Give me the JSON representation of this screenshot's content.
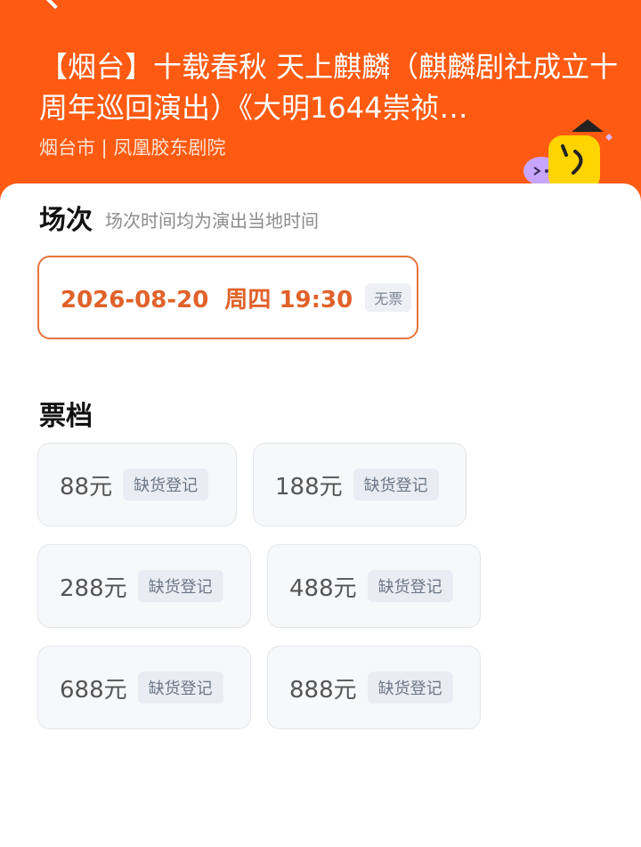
{
  "header": {
    "title": "【烟台】十载春秋 天上麒麟（麒麟剧社成立十周年巡回演出）《大明1644崇祯…",
    "venue": "烟台市 | 凤凰胶东剧院"
  },
  "sessions": {
    "heading": "场次",
    "note": "场次时间均为演出当地时间",
    "selected": {
      "datetime": "2026-08-20  周四 19:30",
      "status": "无票"
    }
  },
  "tiers": {
    "heading": "票档",
    "items": [
      {
        "price": "88元",
        "status": "缺货登记"
      },
      {
        "price": "188元",
        "status": "缺货登记"
      },
      {
        "price": "288元",
        "status": "缺货登记"
      },
      {
        "price": "488元",
        "status": "缺货登记"
      },
      {
        "price": "688元",
        "status": "缺货登记"
      },
      {
        "price": "888元",
        "status": "缺货登记"
      }
    ]
  },
  "colors": {
    "brand": "#ff5a12",
    "selected_border": "#e8743a",
    "selected_text": "#e0622a"
  }
}
